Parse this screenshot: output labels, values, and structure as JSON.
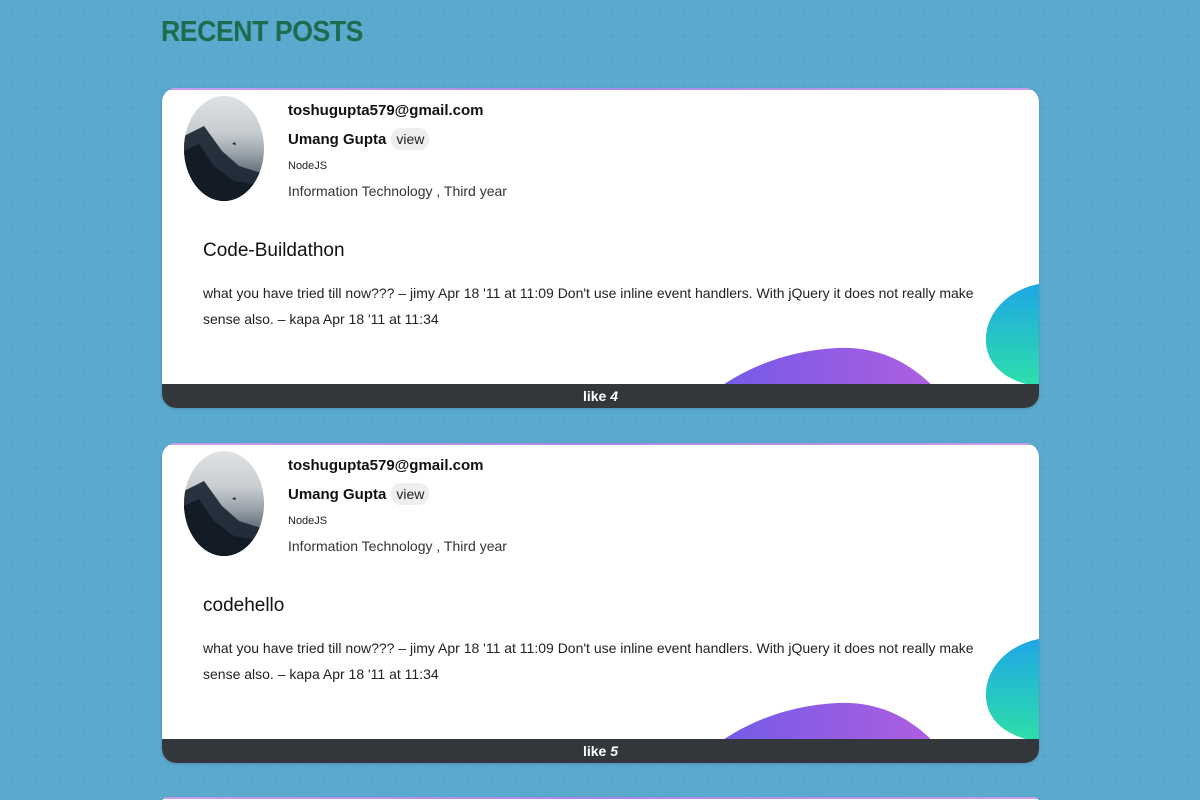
{
  "page": {
    "section_title": "RECENT POSTS"
  },
  "posts": [
    {
      "email": "toshugupta579@gmail.com",
      "author_name": "Umang Gupta",
      "view_label": "view",
      "skill": "NodeJS",
      "department": "Information Technology , Third year",
      "title": "Code-Buildathon",
      "body": "what you have tried till now??? – jimy Apr 18 '11 at 11:09 Don't use inline event handlers. With jQuery it does not really make sense also. – kapa Apr 18 '11 at 11:34",
      "like_label": "like",
      "like_count": "4"
    },
    {
      "email": "toshugupta579@gmail.com",
      "author_name": "Umang Gupta",
      "view_label": "view",
      "skill": "NodeJS",
      "department": "Information Technology , Third year",
      "title": "codehello",
      "body": "what you have tried till now??? – jimy Apr 18 '11 at 11:09 Don't use inline event handlers. With jQuery it does not really make sense also. – kapa Apr 18 '11 at 11:34",
      "like_label": "like",
      "like_count": "5"
    }
  ],
  "colors": {
    "page_background": "#5aa9cf",
    "section_title": "#1e6b4f",
    "card_background": "#ffffff",
    "like_bar": "#33373b",
    "wave_gradient_start": "#7b5ce8",
    "wave_gradient_end": "#a35fe0",
    "blob_gradient_start": "#1fa6e6",
    "blob_gradient_end": "#2ee0a8"
  },
  "icons": {
    "avatar": "misty-mountain-photo"
  }
}
